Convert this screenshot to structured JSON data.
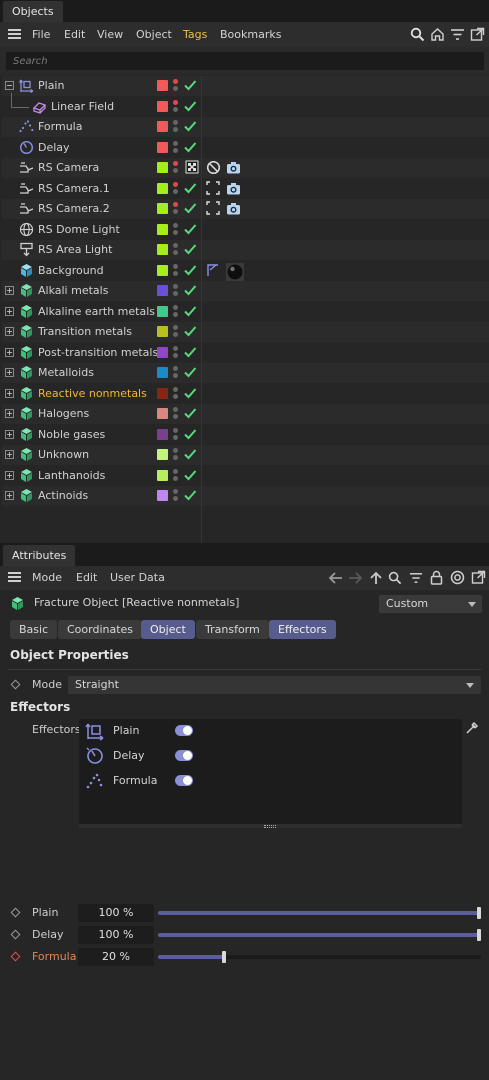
{
  "objects_panel": {
    "tab_label": "Objects",
    "menu": [
      "File",
      "Edit",
      "View",
      "Object",
      "Tags",
      "Bookmarks"
    ],
    "search_placeholder": "Search",
    "rows": [
      {
        "label": "Plain",
        "icon": "plain-effector-icon",
        "color": "#f25a5a",
        "expander": "minus",
        "dots": "red-top"
      },
      {
        "label": "Linear Field",
        "icon": "linear-field-icon",
        "color": "#f25a5a",
        "expander": "none",
        "dots": "red-top"
      },
      {
        "label": "Formula",
        "icon": "formula-effector-icon",
        "color": "#f25a5a",
        "expander": "none",
        "dots": "grey"
      },
      {
        "label": "Delay",
        "icon": "delay-effector-icon",
        "color": "#f25a5a",
        "expander": "none",
        "dots": "grey"
      },
      {
        "label": "RS Camera",
        "icon": "rs-camera-icon",
        "color": "#a6ee1a",
        "expander": "none",
        "dots": "red-top",
        "tags": [
          "checker-tag-icon",
          "forbidden-tag-icon",
          "camera-tag-icon"
        ]
      },
      {
        "label": "RS Camera.1",
        "icon": "rs-camera-icon",
        "color": "#a6ee1a",
        "expander": "none",
        "dots": "red-top",
        "tags": [
          "target-tag-icon",
          "camera-tag-icon"
        ]
      },
      {
        "label": "RS Camera.2",
        "icon": "rs-camera-icon",
        "color": "#a6ee1a",
        "expander": "none",
        "dots": "red-top",
        "tags": [
          "target-tag-icon",
          "camera-tag-icon"
        ]
      },
      {
        "label": "RS Dome Light",
        "icon": "dome-light-icon",
        "color": "#a6ee1a",
        "expander": "none",
        "dots": "grey"
      },
      {
        "label": "RS Area Light",
        "icon": "area-light-icon",
        "color": "#a6ee1a",
        "expander": "none",
        "dots": "grey"
      },
      {
        "label": "Background",
        "icon": "background-icon",
        "color": "#a6ee1a",
        "expander": "none",
        "dots": "grey",
        "tags": [
          "compositing-tag-icon",
          "material-tag-icon"
        ]
      },
      {
        "label": "Alkali metals",
        "icon": "fracture-icon",
        "color": "#6a4fd8",
        "expander": "plus",
        "dots": "grey"
      },
      {
        "label": "Alkaline earth metals",
        "icon": "fracture-icon",
        "color": "#3fc98e",
        "expander": "plus",
        "dots": "grey"
      },
      {
        "label": "Transition metals",
        "icon": "fracture-icon",
        "color": "#b8c01e",
        "expander": "plus",
        "dots": "grey"
      },
      {
        "label": "Post-transition metals",
        "icon": "fracture-icon",
        "color": "#9145c9",
        "expander": "plus",
        "dots": "grey"
      },
      {
        "label": "Metalloids",
        "icon": "fracture-icon",
        "color": "#1a8ac8",
        "expander": "plus",
        "dots": "grey"
      },
      {
        "label": "Reactive nonmetals",
        "icon": "fracture-icon",
        "color": "#8a2412",
        "expander": "plus",
        "dots": "grey",
        "selected": true
      },
      {
        "label": "Halogens",
        "icon": "fracture-icon",
        "color": "#d98880",
        "expander": "plus",
        "dots": "grey"
      },
      {
        "label": "Noble gases",
        "icon": "fracture-icon",
        "color": "#7a3f8e",
        "expander": "plus",
        "dots": "grey"
      },
      {
        "label": "Unknown",
        "icon": "fracture-icon",
        "color": "#c2f57a",
        "expander": "plus",
        "dots": "grey"
      },
      {
        "label": "Lanthanoids",
        "icon": "fracture-icon",
        "color": "#b6ef5a",
        "expander": "plus",
        "dots": "grey"
      },
      {
        "label": "Actinoids",
        "icon": "fracture-icon",
        "color": "#c085f0",
        "expander": "plus",
        "dots": "grey"
      }
    ]
  },
  "attributes_panel": {
    "tab_label": "Attributes",
    "menu": [
      "Mode",
      "Edit",
      "User Data"
    ],
    "object_title": "Fracture Object [Reactive nonmetals]",
    "preset_value": "Custom",
    "tabs": [
      {
        "label": "Basic",
        "active": false
      },
      {
        "label": "Coordinates",
        "active": false
      },
      {
        "label": "Object",
        "active": true
      },
      {
        "label": "Transform",
        "active": false
      },
      {
        "label": "Effectors",
        "active": true
      }
    ],
    "object_properties": {
      "heading": "Object Properties",
      "mode_label": "Mode",
      "mode_value": "Straight"
    },
    "effectors_section": {
      "heading": "Effectors",
      "list_label": "Effectors",
      "items": [
        {
          "label": "Plain",
          "icon": "plain-effector-icon",
          "enabled": true
        },
        {
          "label": "Delay",
          "icon": "delay-effector-icon",
          "enabled": true
        },
        {
          "label": "Formula",
          "icon": "formula-effector-icon",
          "enabled": true
        }
      ]
    },
    "strengths": [
      {
        "label": "Plain",
        "value": "100 %",
        "fraction": 1.0,
        "highlight": false
      },
      {
        "label": "Delay",
        "value": "100 %",
        "fraction": 1.0,
        "highlight": false
      },
      {
        "label": "Formula",
        "value": "20 %",
        "fraction": 0.2,
        "highlight": true
      }
    ]
  },
  "colors": {
    "accent_active_tab": "#575c8e",
    "toggle_on": "#8a8fd6",
    "selected_label": "#f5b72a",
    "check_green": "#56d97a"
  }
}
